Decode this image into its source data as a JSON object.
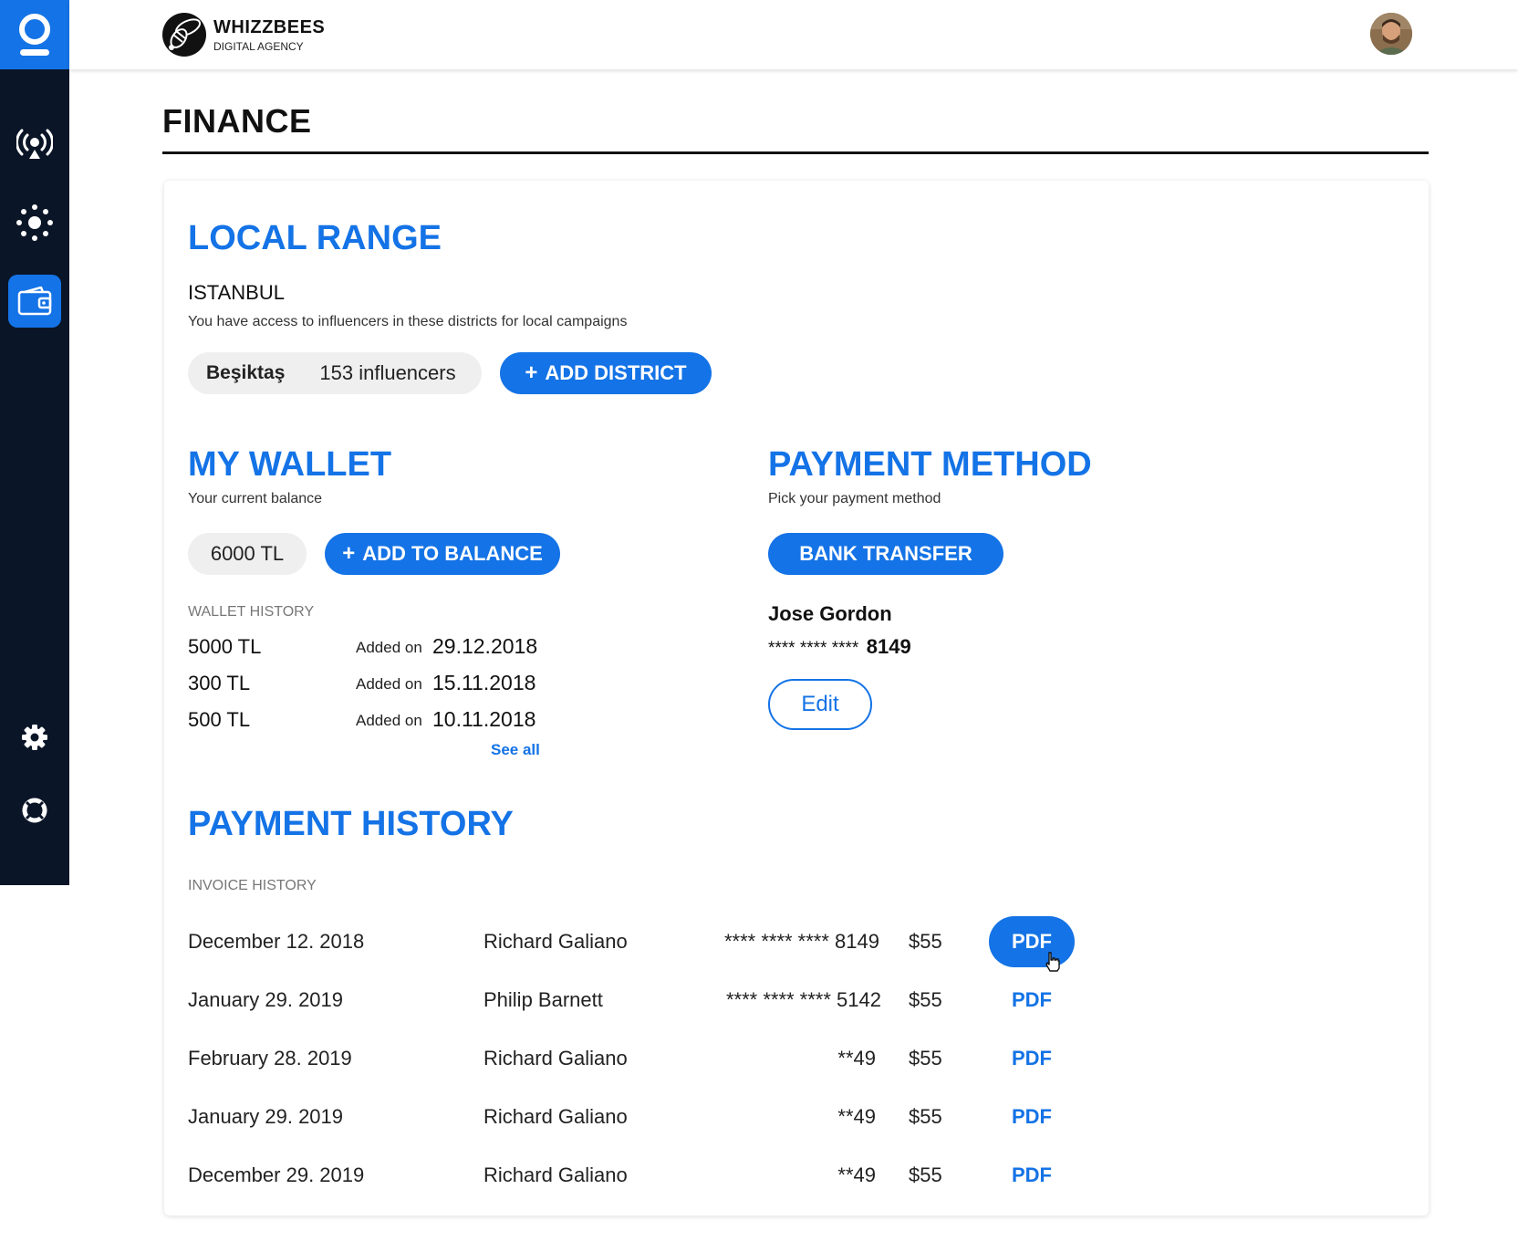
{
  "brand": {
    "name": "WHIZZBEES",
    "sub": "DIGITAL AGENCY"
  },
  "page": {
    "title": "FINANCE"
  },
  "local_range": {
    "title": "LOCAL RANGE",
    "city": "ISTANBUL",
    "description": "You have access to influencers in these districts for local campaigns",
    "district": {
      "name": "Beşiktaş",
      "count": "153 influencers"
    },
    "add_button": "ADD DISTRICT"
  },
  "wallet": {
    "title": "MY WALLET",
    "subtitle": "Your current balance",
    "balance": "6000 TL",
    "add_button": "ADD TO BALANCE",
    "history_label": "WALLET HISTORY",
    "history": [
      {
        "amount": "5000 TL",
        "added": "Added on",
        "date": "29.12.2018"
      },
      {
        "amount": "300 TL",
        "added": "Added on",
        "date": "15.11.2018"
      },
      {
        "amount": "500 TL",
        "added": "Added on",
        "date": "10.11.2018"
      }
    ],
    "see_all": "See all"
  },
  "payment_method": {
    "title": "PAYMENT METHOD",
    "subtitle": "Pick your payment method",
    "button": "BANK TRANSFER",
    "holder": "Jose Gordon",
    "card_mask": "**** **** ****",
    "card_last": "8149",
    "edit": "Edit"
  },
  "payment_history": {
    "title": "PAYMENT HISTORY",
    "label": "INVOICE HISTORY",
    "rows": [
      {
        "date": "December 12. 2018",
        "name": "Richard Galiano",
        "card": "**** **** **** 8149",
        "amount": "$55",
        "pdf": "PDF"
      },
      {
        "date": "January 29. 2019",
        "name": "Philip Barnett",
        "card": "**** **** **** 5142",
        "amount": "$55",
        "pdf": "PDF"
      },
      {
        "date": "February 28. 2019",
        "name": "Richard Galiano",
        "card": "**49",
        "amount": "$55",
        "pdf": "PDF"
      },
      {
        "date": "January 29. 2019",
        "name": "Richard Galiano",
        "card": "**49",
        "amount": "$55",
        "pdf": "PDF"
      },
      {
        "date": "December 29. 2019",
        "name": "Richard Galiano",
        "card": "**49",
        "amount": "$55",
        "pdf": "PDF"
      }
    ]
  },
  "colors": {
    "accent": "#1473e6",
    "sidebar": "#0a1527",
    "pill": "#efefef"
  },
  "icons": [
    "app-logo-icon",
    "broadcast-icon",
    "sun-icon",
    "wallet-icon",
    "gear-icon",
    "lifebuoy-icon",
    "cursor-hand-icon"
  ]
}
